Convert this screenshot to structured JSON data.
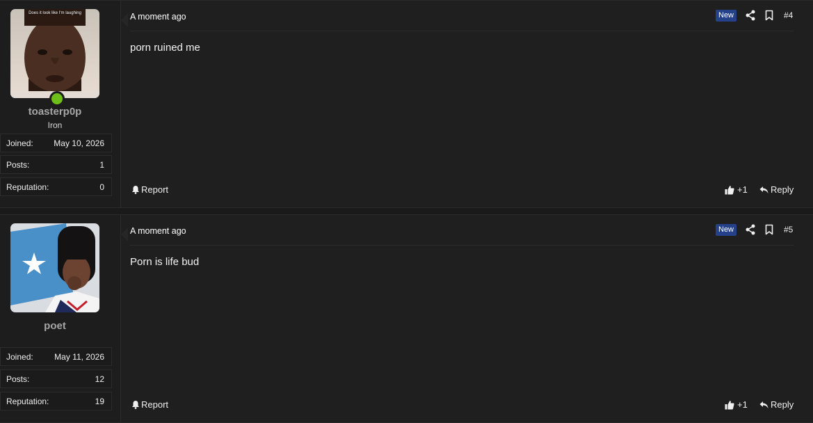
{
  "posts": [
    {
      "author": {
        "name": "toasterp0p",
        "rank": "Iron",
        "avatar_caption": "Does it look like I'm laughing",
        "online": true,
        "stats": [
          {
            "label": "Joined:",
            "value": "May 10, 2026"
          },
          {
            "label": "Posts:",
            "value": "1"
          },
          {
            "label": "Reputation:",
            "value": "0"
          }
        ]
      },
      "time": "A moment ago",
      "badge": "New",
      "number": "#4",
      "message": "porn ruined me",
      "actions": {
        "report": "Report",
        "like": "+1",
        "reply": "Reply"
      }
    },
    {
      "author": {
        "name": "poet",
        "rank": "",
        "stats": [
          {
            "label": "Joined:",
            "value": "May 11, 2026"
          },
          {
            "label": "Posts:",
            "value": "12"
          },
          {
            "label": "Reputation:",
            "value": "19"
          }
        ]
      },
      "time": "A moment ago",
      "badge": "New",
      "number": "#5",
      "message": "Porn is life bud",
      "actions": {
        "report": "Report",
        "like": "+1",
        "reply": "Reply"
      }
    }
  ],
  "colors": {
    "online": "#6fbf1a",
    "badge": "#24418a",
    "username": "#a6a6a6"
  }
}
